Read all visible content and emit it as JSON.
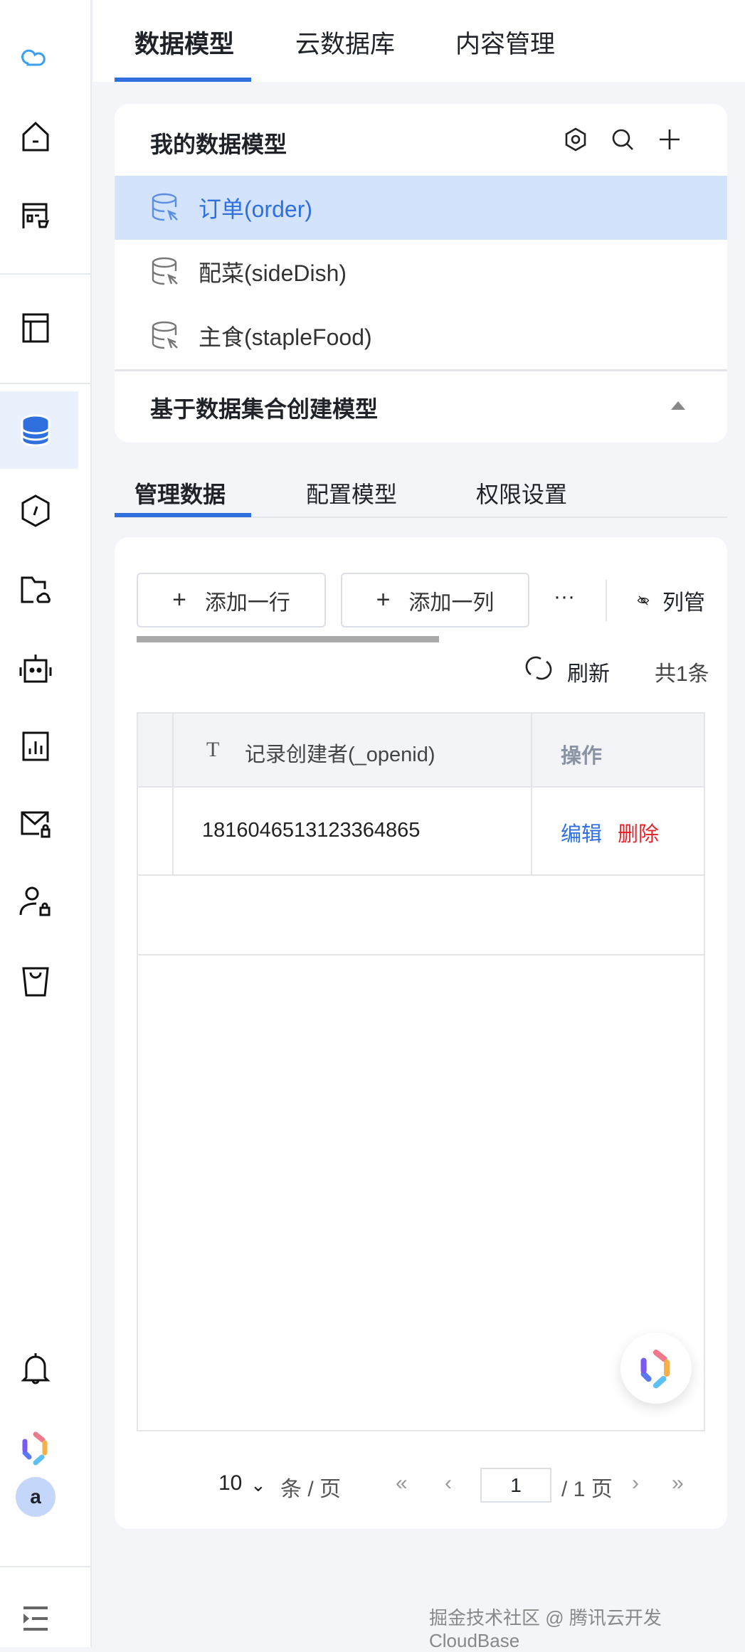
{
  "sidebar": {
    "icons": [
      "cloud-logo",
      "home",
      "store-cart",
      "layout",
      "database",
      "function",
      "folder-cloud",
      "robot",
      "chart",
      "mail-lock",
      "user-lock",
      "bag",
      "bell",
      "ai-star",
      "avatar",
      "collapse"
    ],
    "avatar_letter": "a"
  },
  "top_tabs": [
    {
      "label": "数据模型",
      "active": true
    },
    {
      "label": "云数据库"
    },
    {
      "label": "内容管理"
    }
  ],
  "models": {
    "title": "我的数据模型",
    "items": [
      {
        "label": "订单(order)",
        "selected": true
      },
      {
        "label": "配菜(sideDish)"
      },
      {
        "label": "主食(stapleFood)"
      }
    ],
    "collapsible": "基于数据集合创建模型"
  },
  "sub_tabs": [
    {
      "label": "管理数据",
      "active": true
    },
    {
      "label": "配置模型"
    },
    {
      "label": "权限设置"
    }
  ],
  "toolbar": {
    "add_row": "添加一行",
    "add_col": "添加一列",
    "more": "···",
    "columns": "列管",
    "refresh": "刷新",
    "total": "共1条"
  },
  "table": {
    "headers": [
      "记录创建者(_openid)",
      "操作"
    ],
    "rows": [
      {
        "openid": "1816046513123364865",
        "edit": "编辑",
        "delete": "删除"
      }
    ]
  },
  "pagination": {
    "page_size": "10",
    "per_page": "条 / 页",
    "current": "1",
    "total_pages": "/ 1 页"
  },
  "watermark": "掘金技术社区 @ 腾讯云开发CloudBase",
  "colors": {
    "accent": "#2f6fde",
    "selected_bg": "#d3e3fb",
    "danger": "#e5242b"
  }
}
